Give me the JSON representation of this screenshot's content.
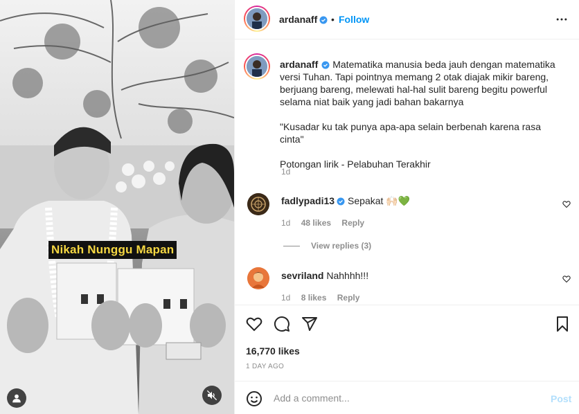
{
  "media": {
    "overlay_caption": "Nikah Nunggu Mapan",
    "icons": {
      "user_tag": "user-icon",
      "mute": "muted-speaker-icon"
    }
  },
  "header": {
    "username": "ardanaff",
    "follow_label": "Follow",
    "bullet": "•",
    "icons": {
      "verified": "verified-badge-icon",
      "more": "more-options-icon"
    }
  },
  "caption": {
    "username": "ardanaff",
    "lines": [
      "Matematika manusia beda jauh dengan matematika",
      "versi Tuhan. Tapi pointnya memang 2 otak diajak mikir bareng,",
      "berjuang bareng, melewati hal-hal sulit bareng begitu powerful",
      "selama niat baik yang jadi bahan bakarnya"
    ],
    "quote": "\"Kusadar ku tak punya apa-apa selain berbenah karena rasa cinta\"",
    "credit": "Potongan lirik - Pelabuhan Terakhir",
    "time": "1d"
  },
  "comments": [
    {
      "username": "fadlypadi13",
      "verified": true,
      "text": "Sepakat 🙌🏻💚",
      "time": "1d",
      "likes": "48 likes",
      "reply_label": "Reply",
      "view_replies": "View replies (3)"
    },
    {
      "username": "sevriland",
      "verified": false,
      "text": "Nahhhh!!!",
      "time": "1d",
      "likes": "8 likes",
      "reply_label": "Reply"
    }
  ],
  "actions": {
    "icons": [
      "heart-icon",
      "comment-icon",
      "share-icon",
      "bookmark-icon"
    ],
    "likes": "16,770 likes",
    "posted_ago": "1 DAY AGO"
  },
  "add_comment": {
    "placeholder": "Add a comment...",
    "post_label": "Post",
    "icon": "emoji-icon"
  },
  "colors": {
    "accent": "#0095f6",
    "overlay_text": "#f5d742",
    "post_disabled": "#b2dffc",
    "muted_text": "#8e8e8e"
  }
}
